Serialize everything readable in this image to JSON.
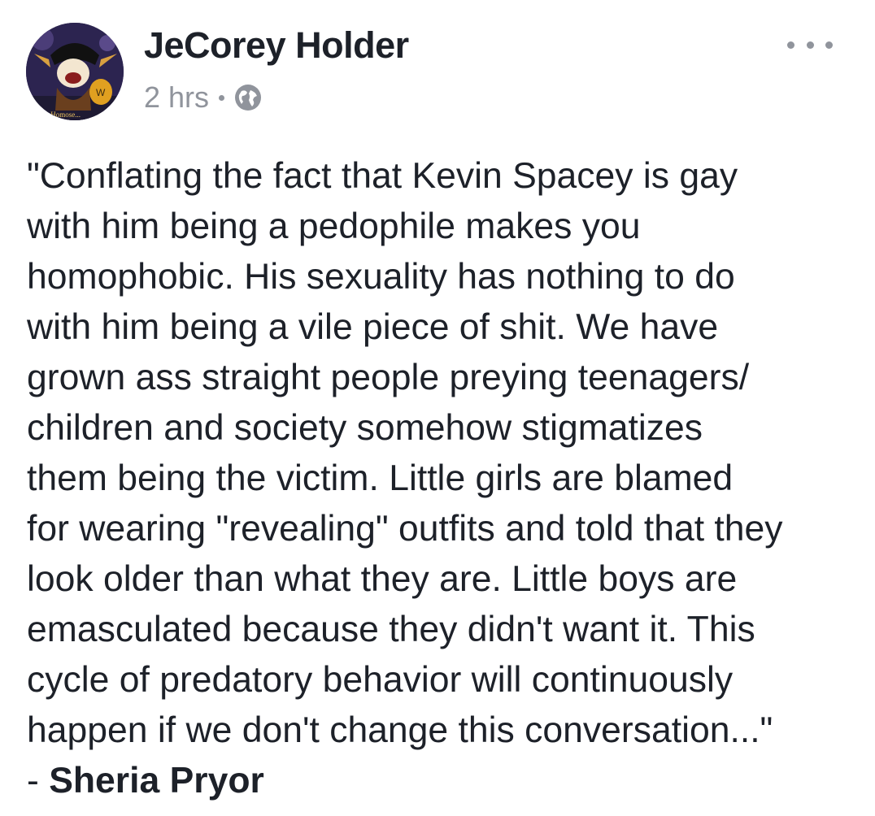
{
  "post": {
    "author": "JeCorey Holder",
    "timestamp": "2 hrs",
    "privacy_icon": "globe-icon",
    "more_icon": "more-options-icon",
    "avatar_caption": "...hs in Homose...",
    "body_lines": [
      "\"Conflating the fact that Kevin Spacey is gay",
      "with him being a pedophile makes you",
      "homophobic. His sexuality has nothing to do",
      "with him being a vile piece of shit. We have",
      "grown ass straight people preying teenagers/",
      "children and society somehow stigmatizes",
      "them being the victim. Little girls are blamed",
      "for wearing \"revealing\" outfits and told that they",
      "look older than what they are. Little boys are",
      "emasculated because they didn't want it. This",
      "cycle of predatory behavior will continuously",
      "happen if we don't change this conversation...\""
    ],
    "attribution_prefix": "- ",
    "attribution_name": "Sheria Pryor"
  },
  "colors": {
    "text": "#1d2129",
    "meta": "#90949c"
  }
}
